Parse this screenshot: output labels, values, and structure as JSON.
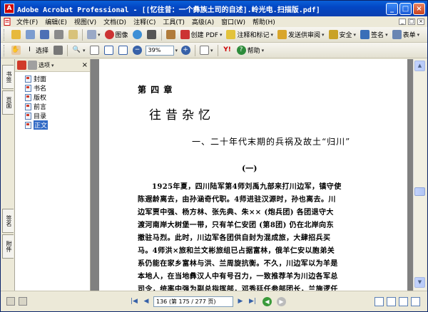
{
  "window": {
    "title": "Adobe Acrobat Professional - [[忆往昔：一个彝族土司的自述].岭光电.扫描版.pdf]",
    "controls": [
      "_",
      "□",
      "×"
    ]
  },
  "menu": {
    "items": [
      "文件(F)",
      "编辑(E)",
      "视图(V)",
      "文档(D)",
      "注释(C)",
      "工具(T)",
      "高级(A)",
      "窗口(W)",
      "帮助(H)"
    ],
    "window_controls": [
      "_",
      "□",
      "×"
    ]
  },
  "toolbar1": {
    "create_pdf": "创建 PDF",
    "comment": "注释和标记",
    "send": "发送供审阅",
    "secure": "安全",
    "sign": "签名",
    "form": "表单",
    "share_label": "图像"
  },
  "toolbar2": {
    "select_label": "选择",
    "zoom_value": "39%",
    "help_label": "帮助"
  },
  "nav_tabs": [
    "书签",
    "页面",
    "签名",
    "附件"
  ],
  "bookmarks": {
    "options_label": "选项",
    "items": [
      {
        "label": "封面"
      },
      {
        "label": "书名"
      },
      {
        "label": "版权"
      },
      {
        "label": "前言"
      },
      {
        "label": "目录"
      },
      {
        "label": "正文"
      }
    ],
    "selected_index": 5
  },
  "page": {
    "chapter": "第 四 章",
    "title": "往昔杂忆",
    "section": "一、二十年代末期的兵祸及故土“归川”",
    "section_num": "(一)",
    "lines": [
      "1925年夏，四川陆军第4师刘禹九部来打川边军，镇守使",
      "陈遐龄离去，由孙涵奇代职。4师进驻汉源时，孙也离去。川",
      "边军贾中强、杨方林、张先典、朱×× (炮兵团) 各团退守大",
      "渡河南岸大树堡一带，只有羊仁安团 (第8团) 仍在北岸向东",
      "撤驻马烈。此时，川边军各团供自封为混成旅，大肆招兵买",
      "马。4师洪×旅和兰文彬旅组已占据富林，俄羊仁安以胞弟关",
      "系仍能在家乡富林与洪、兰周旋抗衡。不久，川边军以为羊是",
      "本地人，在当地彝汉人中有号召力，一致推荐羊为川边各军总",
      "司令，统率中强为副总指挥部，邓秀廷任参部团长，兰施逻任"
    ]
  },
  "status": {
    "page_field": "136 (第 175 / 277 页)"
  }
}
